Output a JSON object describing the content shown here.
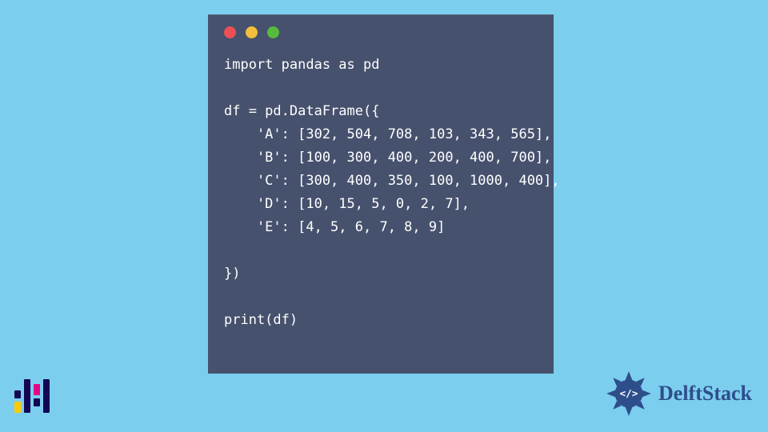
{
  "code_window": {
    "traffic_lights": [
      "red",
      "yellow",
      "green"
    ],
    "lines": [
      "import pandas as pd",
      "",
      "df = pd.DataFrame({",
      "    'A': [302, 504, 708, 103, 343, 565],",
      "    'B': [100, 300, 400, 200, 400, 700],",
      "    'C': [300, 400, 350, 100, 1000, 400],",
      "    'D': [10, 15, 5, 0, 2, 7],",
      "    'E': [4, 5, 6, 7, 8, 9]",
      "",
      "})",
      "",
      "print(df)"
    ]
  },
  "branding": {
    "right_wordmark": "DelftStack"
  },
  "chart_data": {
    "type": "table",
    "title": "DataFrame definition",
    "columns": [
      "A",
      "B",
      "C",
      "D",
      "E"
    ],
    "data": {
      "A": [
        302,
        504,
        708,
        103,
        343,
        565
      ],
      "B": [
        100,
        300,
        400,
        200,
        400,
        700
      ],
      "C": [
        300,
        400,
        350,
        100,
        1000,
        400
      ],
      "D": [
        10,
        15,
        5,
        0,
        2,
        7
      ],
      "E": [
        4,
        5,
        6,
        7,
        8,
        9
      ]
    }
  },
  "colors": {
    "background": "#7cceee",
    "window": "#46516d",
    "brand_blue": "#2e4e8b"
  }
}
